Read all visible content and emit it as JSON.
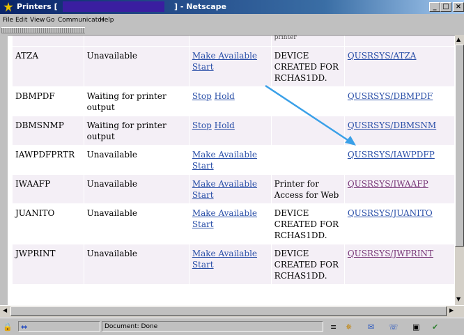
{
  "window": {
    "title_prefix": "Printers [",
    "title_suffix": "] - Netscape",
    "buttons": [
      "_",
      "□",
      "×"
    ]
  },
  "menu": [
    "File",
    "Edit",
    "View",
    "Go",
    "Communicator",
    "Help"
  ],
  "table": {
    "partial_top_text": "printer",
    "rows": [
      {
        "name": "ATZA",
        "status": "Unavailable",
        "actions": [
          "Make Available",
          "Start"
        ],
        "description": "DEVICE CREATED FOR RCHAS1DD.",
        "queue": "QUSRSYS/ATZA",
        "queue_visited": false,
        "shade": true
      },
      {
        "name": "DBMPDF",
        "status": "Waiting for printer output",
        "actions": [
          "Stop",
          "Hold"
        ],
        "description": "",
        "queue": "QUSRSYS/DBMPDF",
        "queue_visited": false,
        "shade": false
      },
      {
        "name": "DBMSNMP",
        "status": "Waiting for printer output",
        "actions": [
          "Stop",
          "Hold"
        ],
        "description": "",
        "queue": "QUSRSYS/DBMSNM",
        "queue_visited": false,
        "shade": true
      },
      {
        "name": "IAWPDFPRTR",
        "status": "Unavailable",
        "actions": [
          "Make Available",
          "Start"
        ],
        "description": "",
        "queue": "QUSRSYS/IAWPDFP",
        "queue_visited": false,
        "shade": false
      },
      {
        "name": "IWAAFP",
        "status": "Unavailable",
        "actions": [
          "Make Available",
          "Start"
        ],
        "description": "Printer for Access for Web",
        "queue": "QUSRSYS/IWAAFP",
        "queue_visited": true,
        "shade": true
      },
      {
        "name": "JUANITO",
        "status": "Unavailable",
        "actions": [
          "Make Available",
          "Start"
        ],
        "description": "DEVICE CREATED FOR RCHAS1DD.",
        "queue": "QUSRSYS/JUANITO",
        "queue_visited": false,
        "shade": false
      },
      {
        "name": "JWPRINT",
        "status": "Unavailable",
        "actions": [
          "Make Available",
          "Start"
        ],
        "description": "DEVICE CREATED FOR RCHAS1DD.",
        "queue": "QUSRSYS/JWPRINT",
        "queue_visited": true,
        "shade": true
      }
    ]
  },
  "status": {
    "text": "Document: Done"
  },
  "colors": {
    "link": "#2a4fa8",
    "visited_link": "#7a3a7a",
    "row_shade": "#f4eff6",
    "annotation_arrow": "#3aa0e8"
  }
}
